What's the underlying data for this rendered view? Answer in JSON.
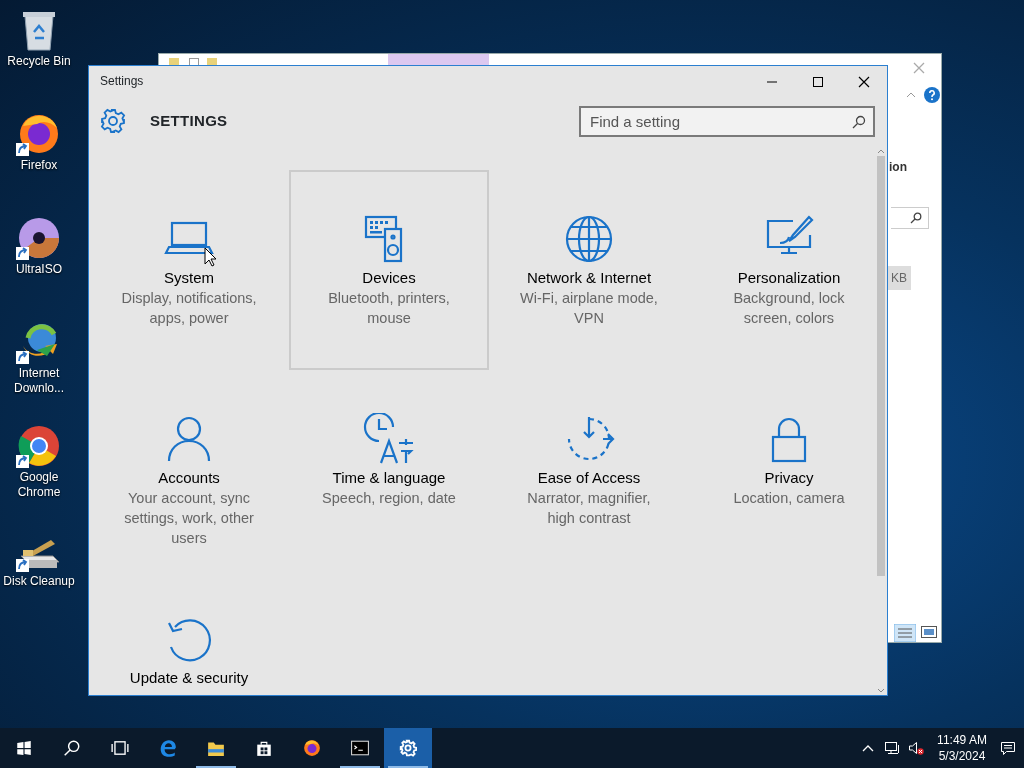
{
  "desktop_icons": [
    {
      "label": "Recycle Bin",
      "kind": "recycle",
      "shortcut": false
    },
    {
      "label": "Firefox",
      "kind": "firefox",
      "shortcut": true
    },
    {
      "label": "UltraISO",
      "kind": "disc",
      "shortcut": true
    },
    {
      "label": "Internet Downlo...",
      "kind": "downloader",
      "shortcut": true
    },
    {
      "label": "Google Chrome",
      "kind": "chrome",
      "shortcut": true
    },
    {
      "label": "Disk Cleanup",
      "kind": "cleanup",
      "shortcut": true
    }
  ],
  "background_window": {
    "texts": [
      "ion",
      "KB"
    ]
  },
  "settings_window": {
    "title": "Settings",
    "header": "SETTINGS",
    "search": {
      "placeholder": "Find a setting"
    },
    "categories": [
      {
        "title": "System",
        "subtitle": "Display, notifications, apps, power",
        "selected": false
      },
      {
        "title": "Devices",
        "subtitle": "Bluetooth, printers, mouse",
        "selected": true
      },
      {
        "title": "Network & Internet",
        "subtitle": "Wi-Fi, airplane mode, VPN",
        "selected": false
      },
      {
        "title": "Personalization",
        "subtitle": "Background, lock screen, colors",
        "selected": false
      },
      {
        "title": "Accounts",
        "subtitle": "Your account, sync settings, work, other users",
        "selected": false
      },
      {
        "title": "Time & language",
        "subtitle": "Speech, region, date",
        "selected": false
      },
      {
        "title": "Ease of Access",
        "subtitle": "Narrator, magnifier, high contrast",
        "selected": false
      },
      {
        "title": "Privacy",
        "subtitle": "Location, camera",
        "selected": false
      },
      {
        "title": "Update & security",
        "selected": false
      }
    ]
  },
  "taskbar": {
    "items": [
      {
        "kind": "start",
        "running": false,
        "selected": false
      },
      {
        "kind": "search",
        "running": false,
        "selected": false
      },
      {
        "kind": "taskview",
        "running": false,
        "selected": false
      },
      {
        "kind": "edge",
        "running": false,
        "selected": false
      },
      {
        "kind": "explorer",
        "running": true,
        "selected": false
      },
      {
        "kind": "store",
        "running": false,
        "selected": false
      },
      {
        "kind": "firefox",
        "running": false,
        "selected": false
      },
      {
        "kind": "terminal",
        "running": true,
        "selected": false
      },
      {
        "kind": "settings",
        "running": true,
        "selected": true
      }
    ],
    "clock": {
      "time": "11:49 AM",
      "date": "5/3/2024"
    }
  }
}
